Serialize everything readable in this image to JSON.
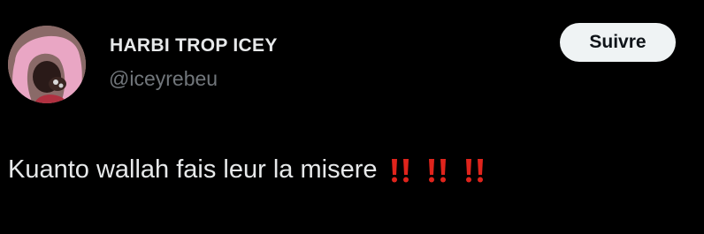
{
  "user": {
    "display_name": "HARBI TROP ICEY",
    "handle": "@iceyrebeu"
  },
  "follow_button": {
    "label": "Suivre"
  },
  "tweet": {
    "text": "Kuanto wallah fais leur la misere",
    "emojis": [
      "double-exclamation-mark-icon",
      "double-exclamation-mark-icon",
      "double-exclamation-mark-icon"
    ]
  },
  "colors": {
    "background": "#000000",
    "primary_text": "#e7e9ea",
    "secondary_text": "#71767b",
    "follow_button_bg": "#eff3f4",
    "follow_button_text": "#0f1419",
    "emoji_red": "#e0241c"
  }
}
